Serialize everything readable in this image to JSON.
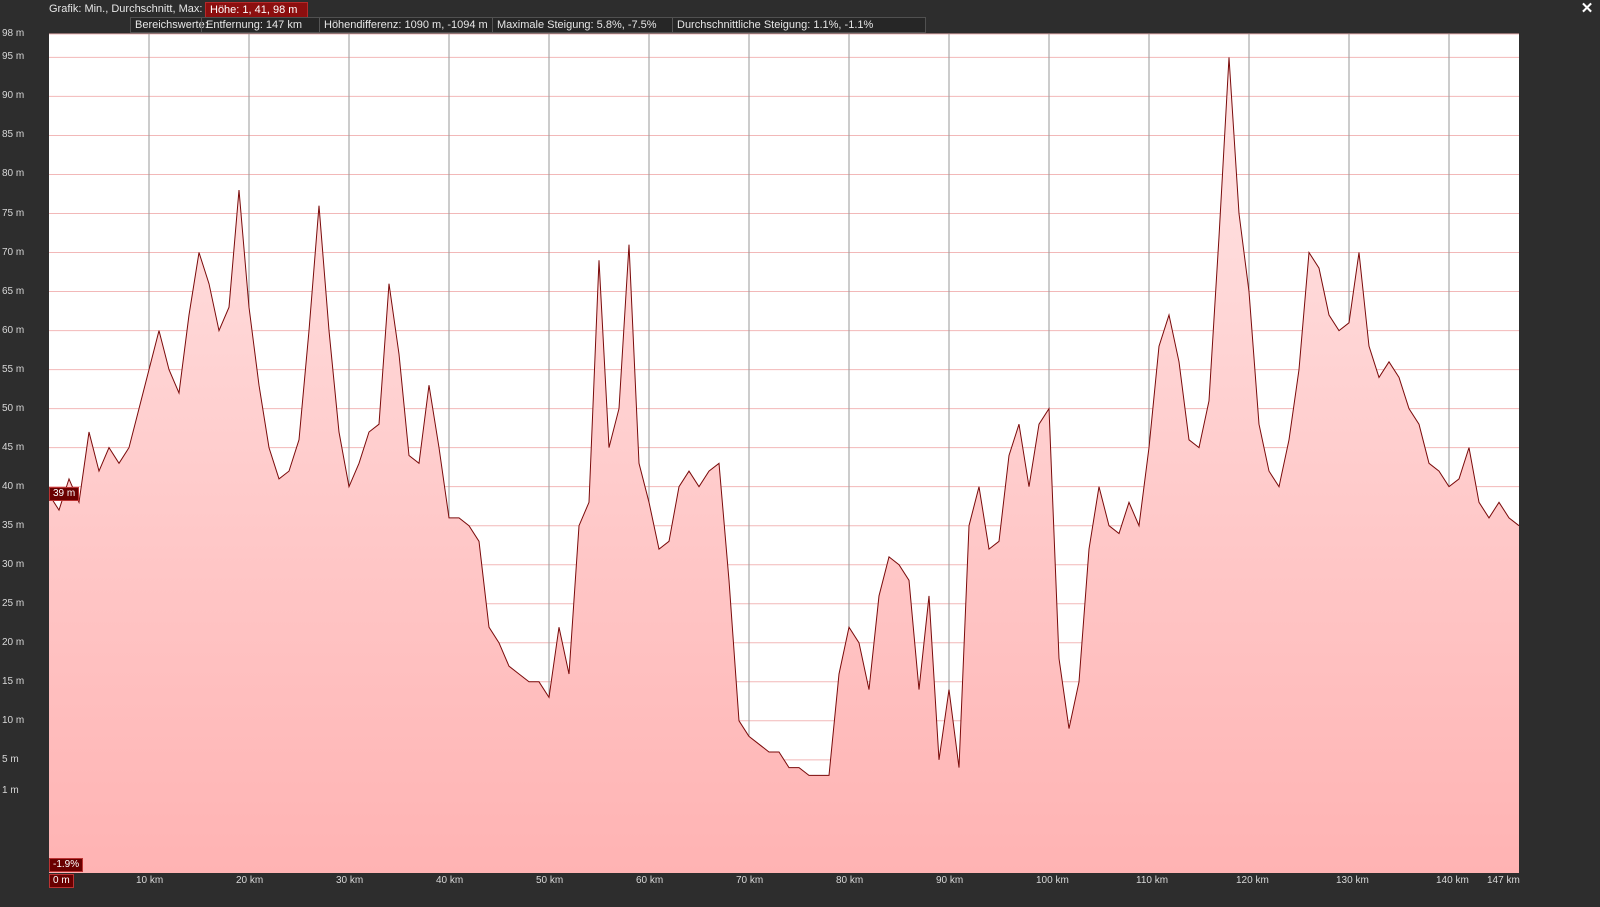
{
  "header": {
    "grafik_label": "Grafik: Min., Durchschnitt, Max:",
    "hoehe": "Höhe: 1, 41, 98 m",
    "close_icon": "close-icon"
  },
  "stats": {
    "bereichswerte": "Bereichswerte:",
    "entfernung": "Entfernung: 147 km",
    "hoehendifferenz": "Höhendifferenz: 1090 m, -1094 m",
    "max_steigung": "Maximale Steigung: 5.8%, -7.5%",
    "avg_steigung": "Durchschnittliche Steigung: 1.1%, -1.1%"
  },
  "markers": {
    "current_height": "39 m",
    "current_slope": "-1.9%",
    "x_start": "0 m",
    "x_end": "147 km"
  },
  "colors": {
    "line": "#7a0a0a",
    "fill_top": "#ffe6e6",
    "fill_bottom": "#ffb3b3",
    "grid_h": "#f2b8b8",
    "grid_v": "#9a9a9a"
  },
  "chart_data": {
    "type": "area",
    "title": "",
    "xlabel": "",
    "ylabel": "",
    "xlim": [
      0,
      147
    ],
    "ylim": [
      -9.5,
      98
    ],
    "ytick_values": [
      98,
      95,
      90,
      85,
      80,
      75,
      70,
      65,
      60,
      55,
      50,
      45,
      40,
      35,
      30,
      25,
      20,
      15,
      10,
      5,
      1
    ],
    "ytick_labels": [
      "98 m",
      "95 m",
      "90 m",
      "85 m",
      "80 m",
      "75 m",
      "70 m",
      "65 m",
      "60 m",
      "55 m",
      "50 m",
      "45 m",
      "40 m",
      "35 m",
      "30 m",
      "25 m",
      "20 m",
      "15 m",
      "10 m",
      "5 m",
      "1 m"
    ],
    "xtick_values": [
      10,
      20,
      30,
      40,
      50,
      60,
      70,
      80,
      90,
      100,
      110,
      120,
      130,
      140
    ],
    "xtick_labels": [
      "10 km",
      "20 km",
      "30 km",
      "40 km",
      "50 km",
      "60 km",
      "70 km",
      "80 km",
      "90 km",
      "100 km",
      "110 km",
      "120 km",
      "130 km",
      "140 km"
    ],
    "series": [
      {
        "x": [
          0,
          1,
          2,
          3,
          4,
          5,
          6,
          7,
          8,
          9,
          10,
          11,
          12,
          13,
          14,
          15,
          16,
          17,
          18,
          19,
          20,
          21,
          22,
          23,
          24,
          25,
          26,
          27,
          28,
          29,
          30,
          31,
          32,
          33,
          34,
          35,
          36,
          37,
          38,
          39,
          40,
          41,
          42,
          43,
          44,
          45,
          46,
          47,
          48,
          49,
          50,
          51,
          52,
          53,
          54,
          55,
          56,
          57,
          58,
          59,
          60,
          61,
          62,
          63,
          64,
          65,
          66,
          67,
          68,
          69,
          70,
          71,
          72,
          73,
          74,
          75,
          76,
          77,
          78,
          79,
          80,
          81,
          82,
          83,
          84,
          85,
          86,
          87,
          88,
          89,
          90,
          91,
          92,
          93,
          94,
          95,
          96,
          97,
          98,
          99,
          100,
          101,
          102,
          103,
          104,
          105,
          106,
          107,
          108,
          109,
          110,
          111,
          112,
          113,
          114,
          115,
          116,
          117,
          118,
          119,
          120,
          121,
          122,
          123,
          124,
          125,
          126,
          127,
          128,
          129,
          130,
          131,
          132,
          133,
          134,
          135,
          136,
          137,
          138,
          139,
          140,
          141,
          142,
          143,
          144,
          145,
          146,
          147
        ],
        "y": [
          39,
          37,
          41,
          38,
          47,
          42,
          45,
          43,
          45,
          50,
          55,
          60,
          55,
          52,
          62,
          70,
          66,
          60,
          63,
          78,
          63,
          53,
          45,
          41,
          42,
          46,
          60,
          76,
          60,
          47,
          40,
          43,
          47,
          48,
          66,
          57,
          44,
          43,
          53,
          45,
          36,
          36,
          35,
          33,
          22,
          20,
          17,
          16,
          15,
          15,
          13,
          22,
          16,
          35,
          38,
          69,
          45,
          50,
          71,
          43,
          38,
          32,
          33,
          40,
          42,
          40,
          42,
          43,
          28,
          10,
          8,
          7,
          6,
          6,
          4,
          4,
          3,
          3,
          3,
          16,
          22,
          20,
          14,
          26,
          31,
          30,
          28,
          14,
          26,
          5,
          14,
          4,
          35,
          40,
          32,
          33,
          44,
          48,
          40,
          48,
          50,
          18,
          9,
          15,
          32,
          40,
          35,
          34,
          38,
          35,
          45,
          58,
          62,
          56,
          46,
          45,
          51,
          72,
          95,
          75,
          65,
          48,
          42,
          40,
          46,
          55,
          70,
          68,
          62,
          60,
          61,
          70,
          58,
          54,
          56,
          54,
          50,
          48,
          43,
          42,
          40,
          41,
          45,
          38,
          36,
          38,
          36,
          35
        ],
        "current_x": 0,
        "current_y": 39
      }
    ]
  }
}
